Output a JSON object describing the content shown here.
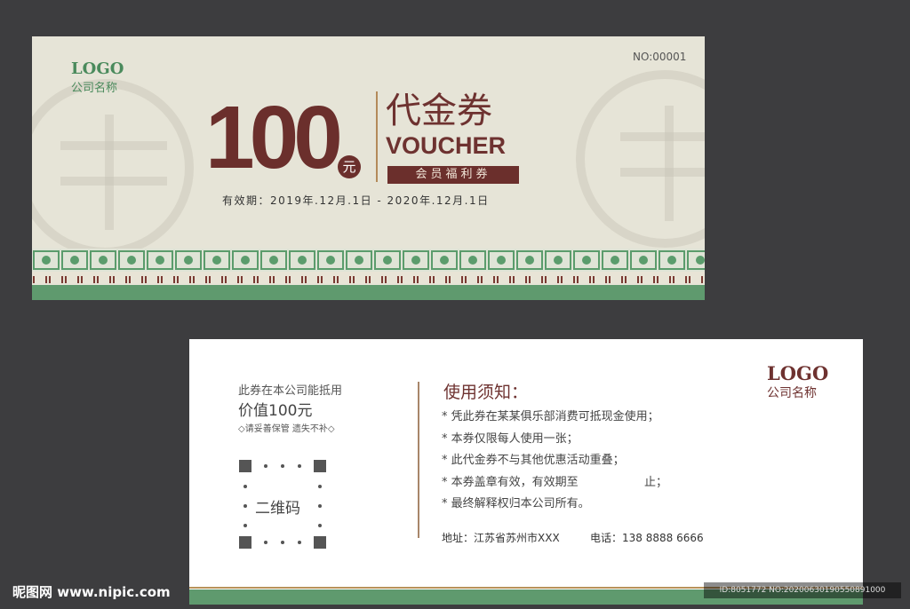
{
  "front": {
    "logo": "LOGO",
    "company": "公司名称",
    "serial": "NO:00001",
    "amount": "100",
    "unit": "元",
    "title_cn": "代金券",
    "title_en": "VOUCHER",
    "tag": "会员福利券",
    "validity": "有效期：2019年.12月.1日 - 2020年.12月.1日"
  },
  "back": {
    "left_line1": "此券在本公司能抵用",
    "left_line2": "价值100元",
    "left_note": "◇请妥善保管 遗失不补◇",
    "qr_label": "二维码",
    "notice_title": "使用须知：",
    "rules": [
      "凭此券在某某俱乐部消费可抵现金使用；",
      "本券仅限每人使用一张；",
      "此代金券不与其他优惠活动重叠；",
      "本券盖章有效，有效期至                  止；",
      "最终解释权归本公司所有。"
    ],
    "address": "地址：江苏省苏州市XXX",
    "phone": "电话：138 8888 6666",
    "logo": "LOGO",
    "company": "公司名称"
  },
  "watermark": {
    "site": "昵图网 www.nipic.com",
    "id": "ID:8051772 NO:20200630190550891000"
  },
  "colors": {
    "brown": "#6e3230",
    "green": "#4a8a5c",
    "cream": "#e6e4d7",
    "background": "#3d3d3f"
  }
}
